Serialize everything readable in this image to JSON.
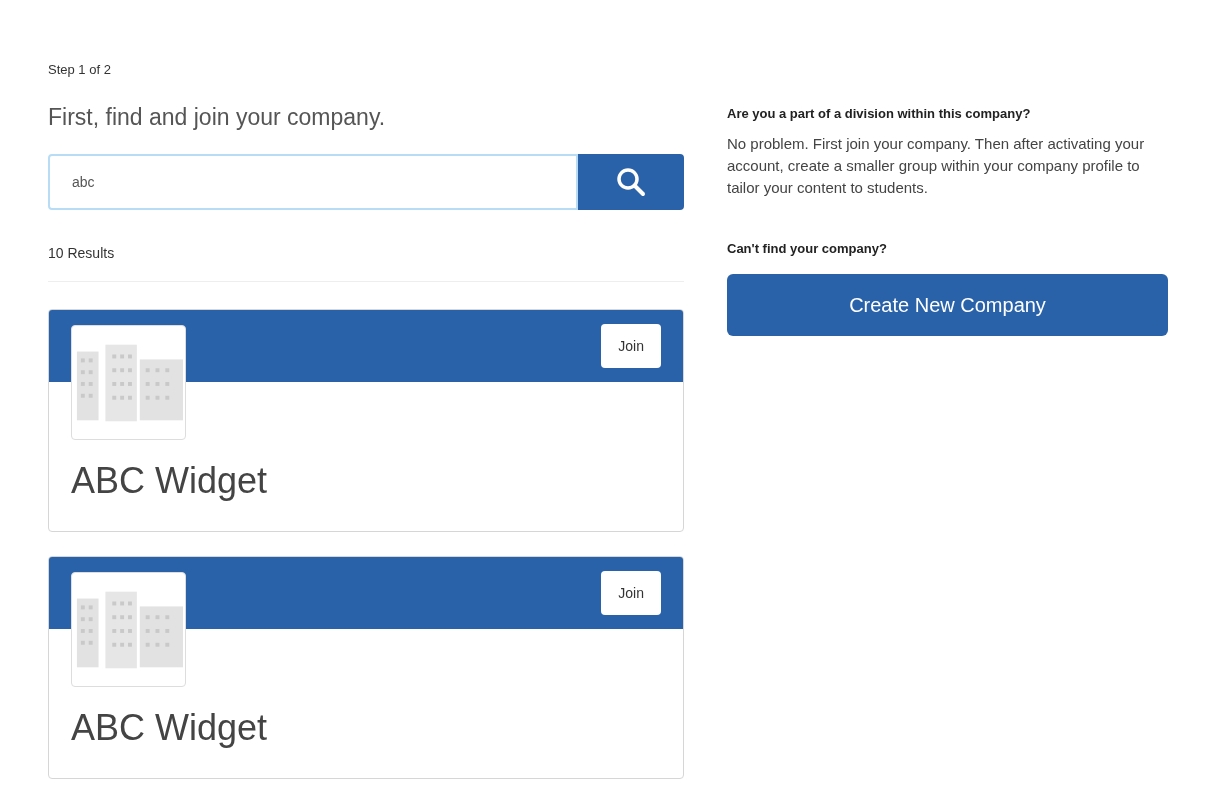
{
  "step": "Step 1 of 2",
  "heading": "First, find and join your company.",
  "search": {
    "value": "abc"
  },
  "results_count": "10 Results",
  "results": [
    {
      "name": "ABC Widget",
      "join_label": "Join"
    },
    {
      "name": "ABC Widget",
      "join_label": "Join"
    }
  ],
  "division": {
    "title": "Are you a part of a division within this company?",
    "text": "No problem. First join your company. Then after activating your account, create a smaller group within your company profile to tailor your content to students."
  },
  "cant_find": {
    "title": "Can't find your company?",
    "button": "Create New Company"
  }
}
